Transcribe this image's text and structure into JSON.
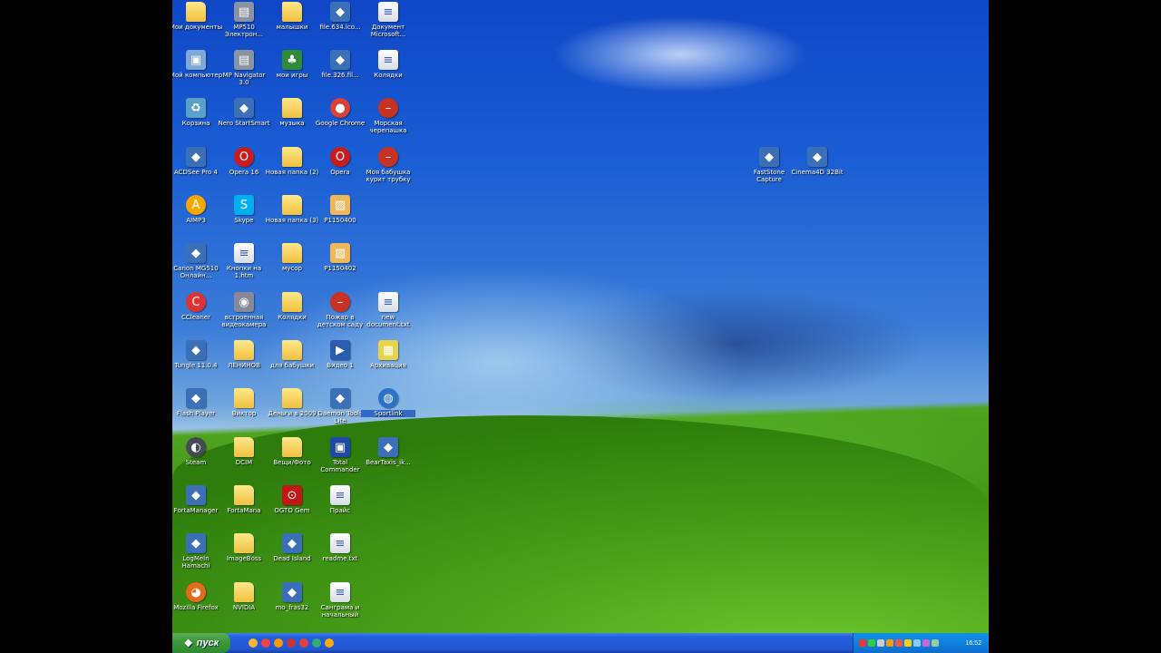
{
  "desktop_icons": [
    {
      "label": "Мои документы",
      "kind": "folder"
    },
    {
      "label": "MP510 Электрон...",
      "kind": "printer"
    },
    {
      "label": "малышки",
      "kind": "folder"
    },
    {
      "label": "file.634.ico...",
      "kind": "app"
    },
    {
      "label": "Документ Microsoft...",
      "kind": "doc"
    },
    {
      "label": "Мой компьютер",
      "kind": "computer"
    },
    {
      "label": "MP Navigator 3.0",
      "kind": "printer"
    },
    {
      "label": "мои игры",
      "kind": "tree"
    },
    {
      "label": "file.326.fil...",
      "kind": "app"
    },
    {
      "label": "Колядки",
      "kind": "doc"
    },
    {
      "label": "Корзина",
      "kind": "recycle"
    },
    {
      "label": "Nero StartSmart",
      "kind": "app"
    },
    {
      "label": "музыка",
      "kind": "folder"
    },
    {
      "label": "Google Chrome",
      "kind": "chrome"
    },
    {
      "label": "Морская черепашка",
      "kind": "stop"
    },
    {
      "label": "ACDSee Pro 4",
      "kind": "app"
    },
    {
      "label": "Opera 16",
      "kind": "opera"
    },
    {
      "label": "Новая папка (2)",
      "kind": "folder"
    },
    {
      "label": "Opera",
      "kind": "opera"
    },
    {
      "label": "Моя бабушка курит трубку",
      "kind": "stop"
    },
    {
      "label": "AIMP3",
      "kind": "aimp"
    },
    {
      "label": "Skype",
      "kind": "skype"
    },
    {
      "label": "Новая папка (3)",
      "kind": "folder"
    },
    {
      "label": "P1150400",
      "kind": "image"
    },
    {
      "label": "Canon MG510 Онлайн...",
      "kind": "app"
    },
    {
      "label": "Кнопки на 1.htm",
      "kind": "doc"
    },
    {
      "label": "мусор",
      "kind": "folder"
    },
    {
      "label": "P1150402",
      "kind": "image"
    },
    {
      "label": "CCleaner",
      "kind": "ccleaner"
    },
    {
      "label": "встроенная видеокамера",
      "kind": "camera"
    },
    {
      "label": "Колядки",
      "kind": "folder"
    },
    {
      "label": "Пожар в детском саду",
      "kind": "stop"
    },
    {
      "label": "new document.txt",
      "kind": "doc"
    },
    {
      "label": "Tungle 11.0.4",
      "kind": "app"
    },
    {
      "label": "ЛЕНИНОВ",
      "kind": "folder"
    },
    {
      "label": "для бабушки",
      "kind": "folder"
    },
    {
      "label": "Видео 1",
      "kind": "video"
    },
    {
      "label": "Архивация",
      "kind": "archive"
    },
    {
      "label": "Flash Player",
      "kind": "app"
    },
    {
      "label": "Виктор",
      "kind": "folder"
    },
    {
      "label": "Деньги в 2009",
      "kind": "folder"
    },
    {
      "label": "Daemon Tools Lite",
      "kind": "app"
    },
    {
      "label": "Sportlink",
      "kind": "globe"
    },
    {
      "label": "Steam",
      "kind": "steam"
    },
    {
      "label": "DCIM",
      "kind": "folder"
    },
    {
      "label": "Вещи/Фото",
      "kind": "folder"
    },
    {
      "label": "Total Commander",
      "kind": "floppy"
    },
    {
      "label": "BearTaxis_ik...",
      "kind": "app"
    },
    {
      "label": "FortaManager",
      "kind": "app"
    },
    {
      "label": "FortaMana",
      "kind": "folder"
    },
    {
      "label": "OGTO Gem",
      "kind": "pdf"
    },
    {
      "label": "Прайс",
      "kind": "doc"
    },
    {
      "label": "LogMeIn Hamachi",
      "kind": "app"
    },
    {
      "label": "ImageBoss",
      "kind": "folder"
    },
    {
      "label": "Dead Island",
      "kind": "app"
    },
    {
      "label": "readme.txt",
      "kind": "doc"
    },
    {
      "label": "Mozilla Firefox",
      "kind": "firefox"
    },
    {
      "label": "NVIDIA",
      "kind": "folder"
    },
    {
      "label": "mo_fras32",
      "kind": "app"
    },
    {
      "label": "Санграма и начальный",
      "kind": "doc"
    },
    {
      "label": "FastStone Capture",
      "kind": "app"
    },
    {
      "label": "Cinema4D 32Bit",
      "kind": "app"
    }
  ],
  "taskbar": {
    "start_label": "пуск",
    "clock": "16:52"
  },
  "colors": {
    "folder": "#f0c040",
    "taskbar": "#245edb",
    "start": "#3c9a3a"
  }
}
